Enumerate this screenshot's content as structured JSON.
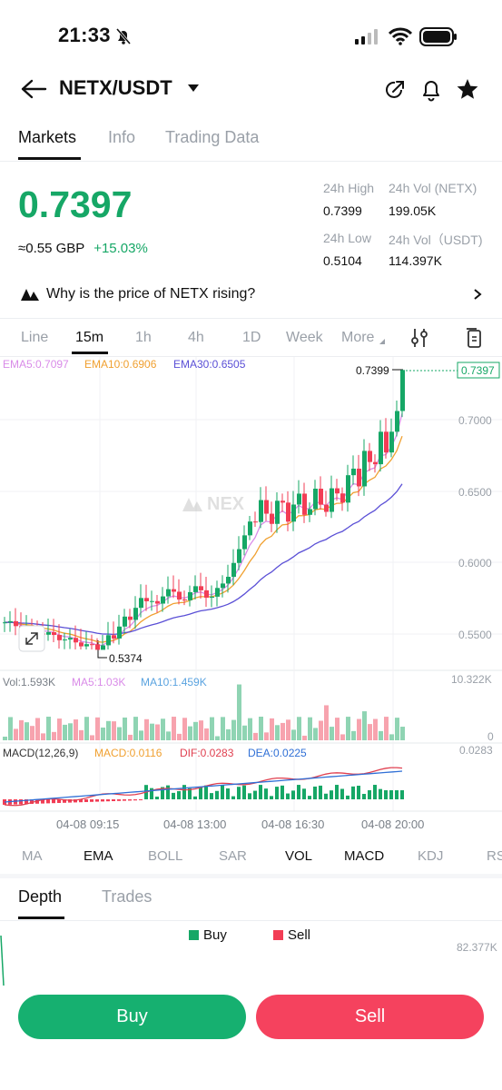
{
  "status": {
    "time": "21:33"
  },
  "header": {
    "pair": "NETX/USDT"
  },
  "tabs": [
    "Markets",
    "Info",
    "Trading Data"
  ],
  "price": {
    "last": "0.7397",
    "fiat": "≈0.55  GBP",
    "change": "+15.03%"
  },
  "stats": {
    "high_label": "24h High",
    "high_value": "0.7399",
    "vol_netx_label": "24h Vol (NETX)",
    "vol_netx_value": "199.05K",
    "low_label": "24h Low",
    "low_value": "0.5104",
    "vol_usdt_label": "24h Vol（USDT)",
    "vol_usdt_value": "114.397K"
  },
  "why": {
    "text": "Why is the price of NETX rising?"
  },
  "timeframes": [
    "Line",
    "15m",
    "1h",
    "4h",
    "1D",
    "Week",
    "More"
  ],
  "colors": {
    "up": "#16a766",
    "down": "#f23d55",
    "ema5": "#d98be8",
    "ema10": "#f0a030",
    "ema30": "#5a4fd6",
    "dif": "#e04050",
    "dea": "#2f6fd6"
  },
  "chart": {
    "ema_legend": [
      "EMA5:0.7097",
      "EMA10:0.6906",
      "EMA30:0.6505"
    ],
    "price_ticks": [
      "0.7000",
      "0.6500",
      "0.6000",
      "0.5500"
    ],
    "current_price_tag": "0.7397",
    "high_marker": "0.7399",
    "low_marker": "0.5374",
    "vol_legend": [
      "Vol:1.593K",
      "MA5:1.03K",
      "MA10:1.459K"
    ],
    "vol_max": "10.322K",
    "vol_zero": "0",
    "macd_legend": [
      "MACD(12,26,9)",
      "MACD:0.0116",
      "DIF:0.0283",
      "DEA:0.0225"
    ],
    "macd_max": "0.0283",
    "time_ticks": [
      "04-08 09:15",
      "04-08 13:00",
      "04-08 16:30",
      "04-08 20:00"
    ],
    "watermark": "NEX"
  },
  "chart_data": {
    "type": "candlestick",
    "interval": "15m",
    "ylim": [
      0.5374,
      0.7399
    ],
    "last_price": 0.7397,
    "high": 0.7399,
    "low": 0.5374,
    "ema": {
      "ema5": 0.7097,
      "ema10": 0.6906,
      "ema30": 0.6505
    },
    "volume": {
      "last": "1.593K",
      "ma5": "1.03K",
      "ma10": "1.459K",
      "max": "10.322K"
    },
    "macd": {
      "macd": 0.0116,
      "dif": 0.0283,
      "dea": 0.0225
    }
  },
  "indicators": [
    "MA",
    "EMA",
    "BOLL",
    "SAR",
    "VOL",
    "MACD",
    "KDJ",
    "RS"
  ],
  "bottom_tabs": [
    "Depth",
    "Trades"
  ],
  "depth": {
    "buy_label": "Buy",
    "sell_label": "Sell",
    "max": "82.377K"
  },
  "actions": {
    "buy": "Buy",
    "sell": "Sell"
  }
}
